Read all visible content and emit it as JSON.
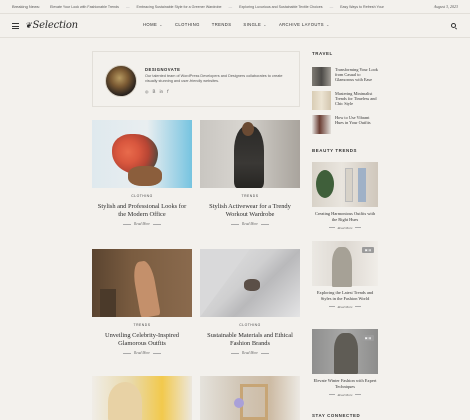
{
  "ticker": {
    "label": "Breaking News:",
    "items": [
      "Elevate Your Look with Fashionable Trends",
      "Embracing Sustainable Style for a Greener Wardrobe",
      "Exploring Luxurious and Sustainable Textile Choices",
      "Easy Ways to Refresh Your"
    ],
    "date": "August 3, 2023"
  },
  "nav": {
    "logo": "Selection",
    "menu": [
      "HOME",
      "CLOTHING",
      "TRENDS",
      "SINGLE",
      "ARCHIVE LAYOUTS"
    ]
  },
  "author": {
    "name": "DESIGNOVATE",
    "bio": "Our talented team of WordPress Developers and Designers collaborates to create visually stunning and user-friendly websites.",
    "social": [
      "◎",
      "𝔹",
      "in",
      "f"
    ]
  },
  "posts": [
    {
      "category": "CLOTHING",
      "title": "Stylish and Professional Looks for the Modern Office",
      "read_more": "Read More"
    },
    {
      "category": "TRENDS",
      "title": "Stylish Activewear for a Trendy Workout Wardrobe",
      "read_more": "Read More"
    },
    {
      "category": "TRENDS",
      "title": "Unveiling Celebrity-Inspired Glamorous Outfits",
      "read_more": "Read More"
    },
    {
      "category": "CLOTHING",
      "title": "Sustainable Materials and Ethical Fashion Brands",
      "read_more": "Read More"
    }
  ],
  "sidebar": {
    "travel_heading": "TRAVEL",
    "travel": [
      "Transforming Your Look from Casual to Glamorous with Ease",
      "Mastering Minimalist Trends for Timeless and Chic Style",
      "How to Use Vibrant Hues in Your Outfits"
    ],
    "beauty_heading": "BEAUTY TRENDS",
    "beauty": [
      {
        "title": "Creating Harmonious Outfits with the Right Hues",
        "read_more": "Read More"
      },
      {
        "title": "Exploring the Latest Trends and Styles in the Fashion World",
        "read_more": "Read More"
      },
      {
        "title": "Elevate Winter Fashion with Expert Techniques",
        "read_more": "Read More"
      }
    ],
    "connect_heading": "STAY CONNECTED"
  }
}
